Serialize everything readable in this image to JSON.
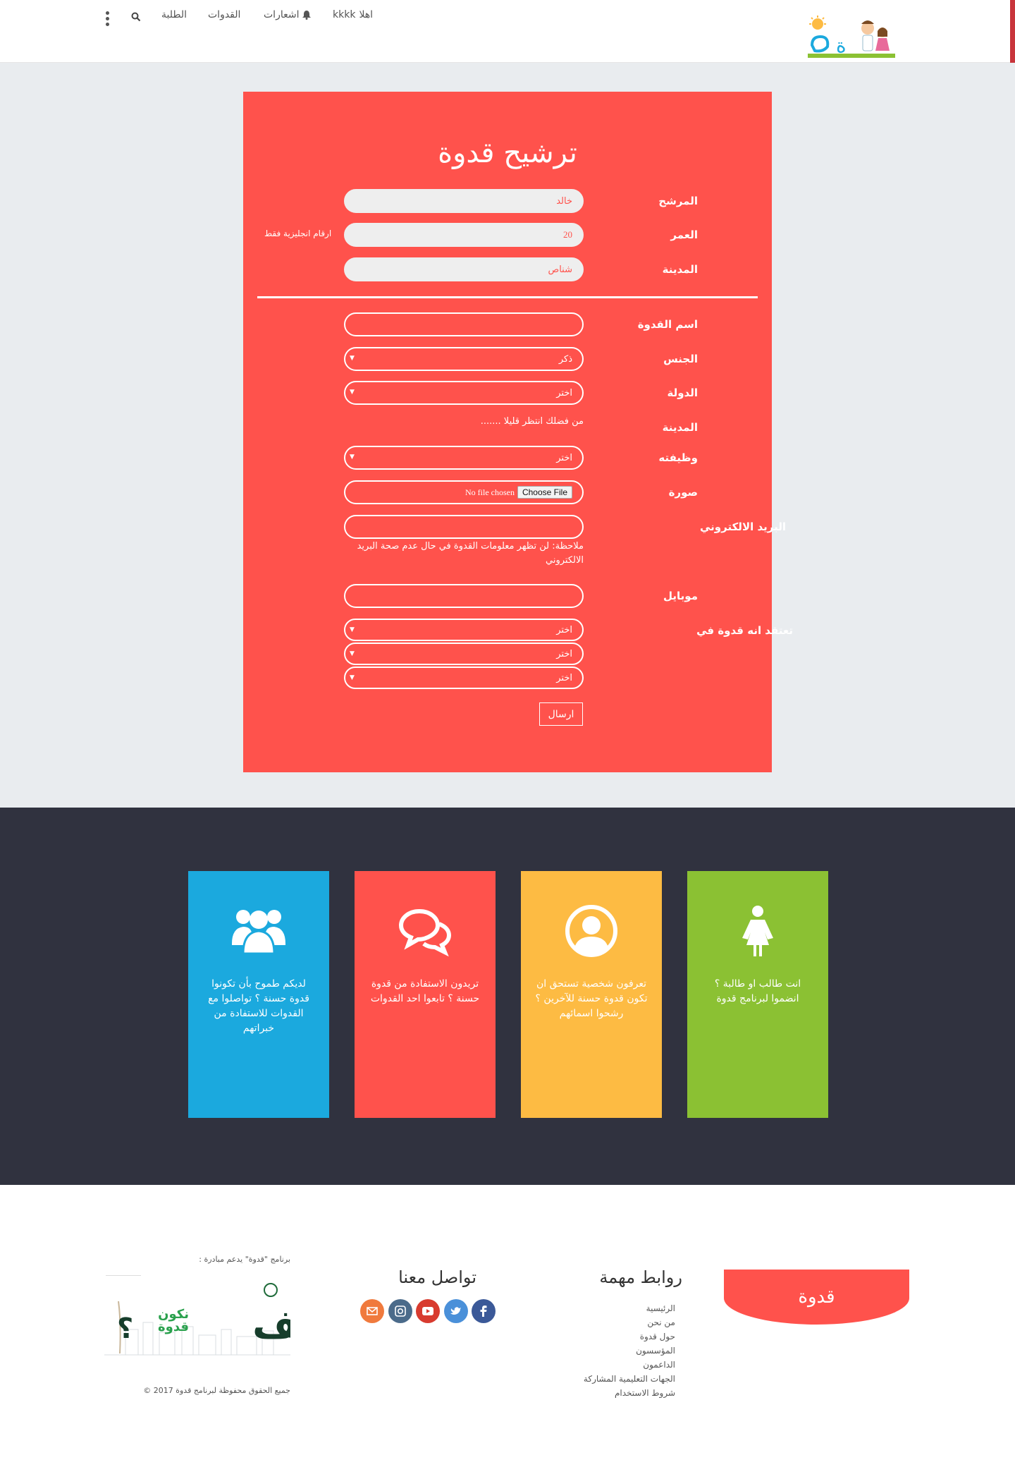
{
  "header": {
    "greeting": "اهلا",
    "username": "kkkk",
    "notifications_label": "اشعارات",
    "role_models_label": "القدوات",
    "students_label": "الطلبة",
    "logo_text": "قدوة"
  },
  "form": {
    "title": "ترشيح قدوة",
    "nominator_label": "المرشح",
    "nominator_value": "خالد",
    "age_label": "العمر",
    "age_value": "20",
    "age_hint": "ارقام انجليزية فقط",
    "nominator_city_label": "المدينة",
    "nominator_city_value": "شناص",
    "model_name_label": "اسم القدوة",
    "model_name_value": "",
    "gender_label": "الجنس",
    "gender_value": "ذكر",
    "country_label": "الدولة",
    "country_value": "اختر",
    "city_label": "المدينة",
    "city_loading": "من فضلك انتظر قليلا .......",
    "job_label": "وظيفته",
    "job_value": "اختر",
    "photo_label": "صورة",
    "choose_file": "Choose File",
    "no_file": "No file chosen",
    "email_label": "البريد الالكتروني",
    "email_value": "",
    "email_note": "ملاحظة: لن تظهر معلومات القدوة في حال عدم صحة البريد الالكتروني",
    "mobile_label": "موبايل",
    "mobile_value": "",
    "believe_label": "تعتقد انه قدوة في",
    "believe_1": "اختر",
    "believe_2": "اختر",
    "believe_3": "اختر",
    "submit_label": "ارسال"
  },
  "tiles": [
    {
      "text": "لديكم طموح بأن تكونوا قدوة حسنة ؟ تواصلوا مع القدوات للاستفادة من خبراتهم",
      "color": "#1ba9de",
      "icon": "group-icon"
    },
    {
      "text": "تريدون الاستفادة من قدوة حسنة ؟ تابعوا احد القدوات",
      "color": "#ff524c",
      "icon": "chat-bubbles-icon"
    },
    {
      "text": "تعرفون شخصية تستحق ان تكون قدوة حسنة للآخرين ؟ رشحوا اسمائهم",
      "color": "#fdbb43",
      "icon": "user-circle-icon"
    },
    {
      "text": "انت طالب او طالبة ؟ انضموا لبرنامج قدوة",
      "color": "#8bc133",
      "icon": "female-icon"
    }
  ],
  "footer": {
    "brand": "قدوة",
    "links_title": "روابط مهمة",
    "links": [
      "الرئيسية",
      "من نحن",
      "حول قدوة",
      "المؤسسون",
      "الداعمون",
      "الجهات التعليمية المشاركة",
      "شروط الاستخدام"
    ],
    "contact_title": "تواصل معنا",
    "support_text": "برنامج \"قدوة\" يدعم مبادرة :",
    "campaign_big": "كيف",
    "campaign_small_1": "نكون",
    "campaign_small_2": "قدوة",
    "copyright": "جميع الحقوق محفوظة لبرنامج قدوة 2017 ©"
  },
  "colors": {
    "accent": "#ff524c",
    "dark": "#30323f",
    "blue": "#1ba9de",
    "yellow": "#fdbb43",
    "green": "#8bc133"
  }
}
